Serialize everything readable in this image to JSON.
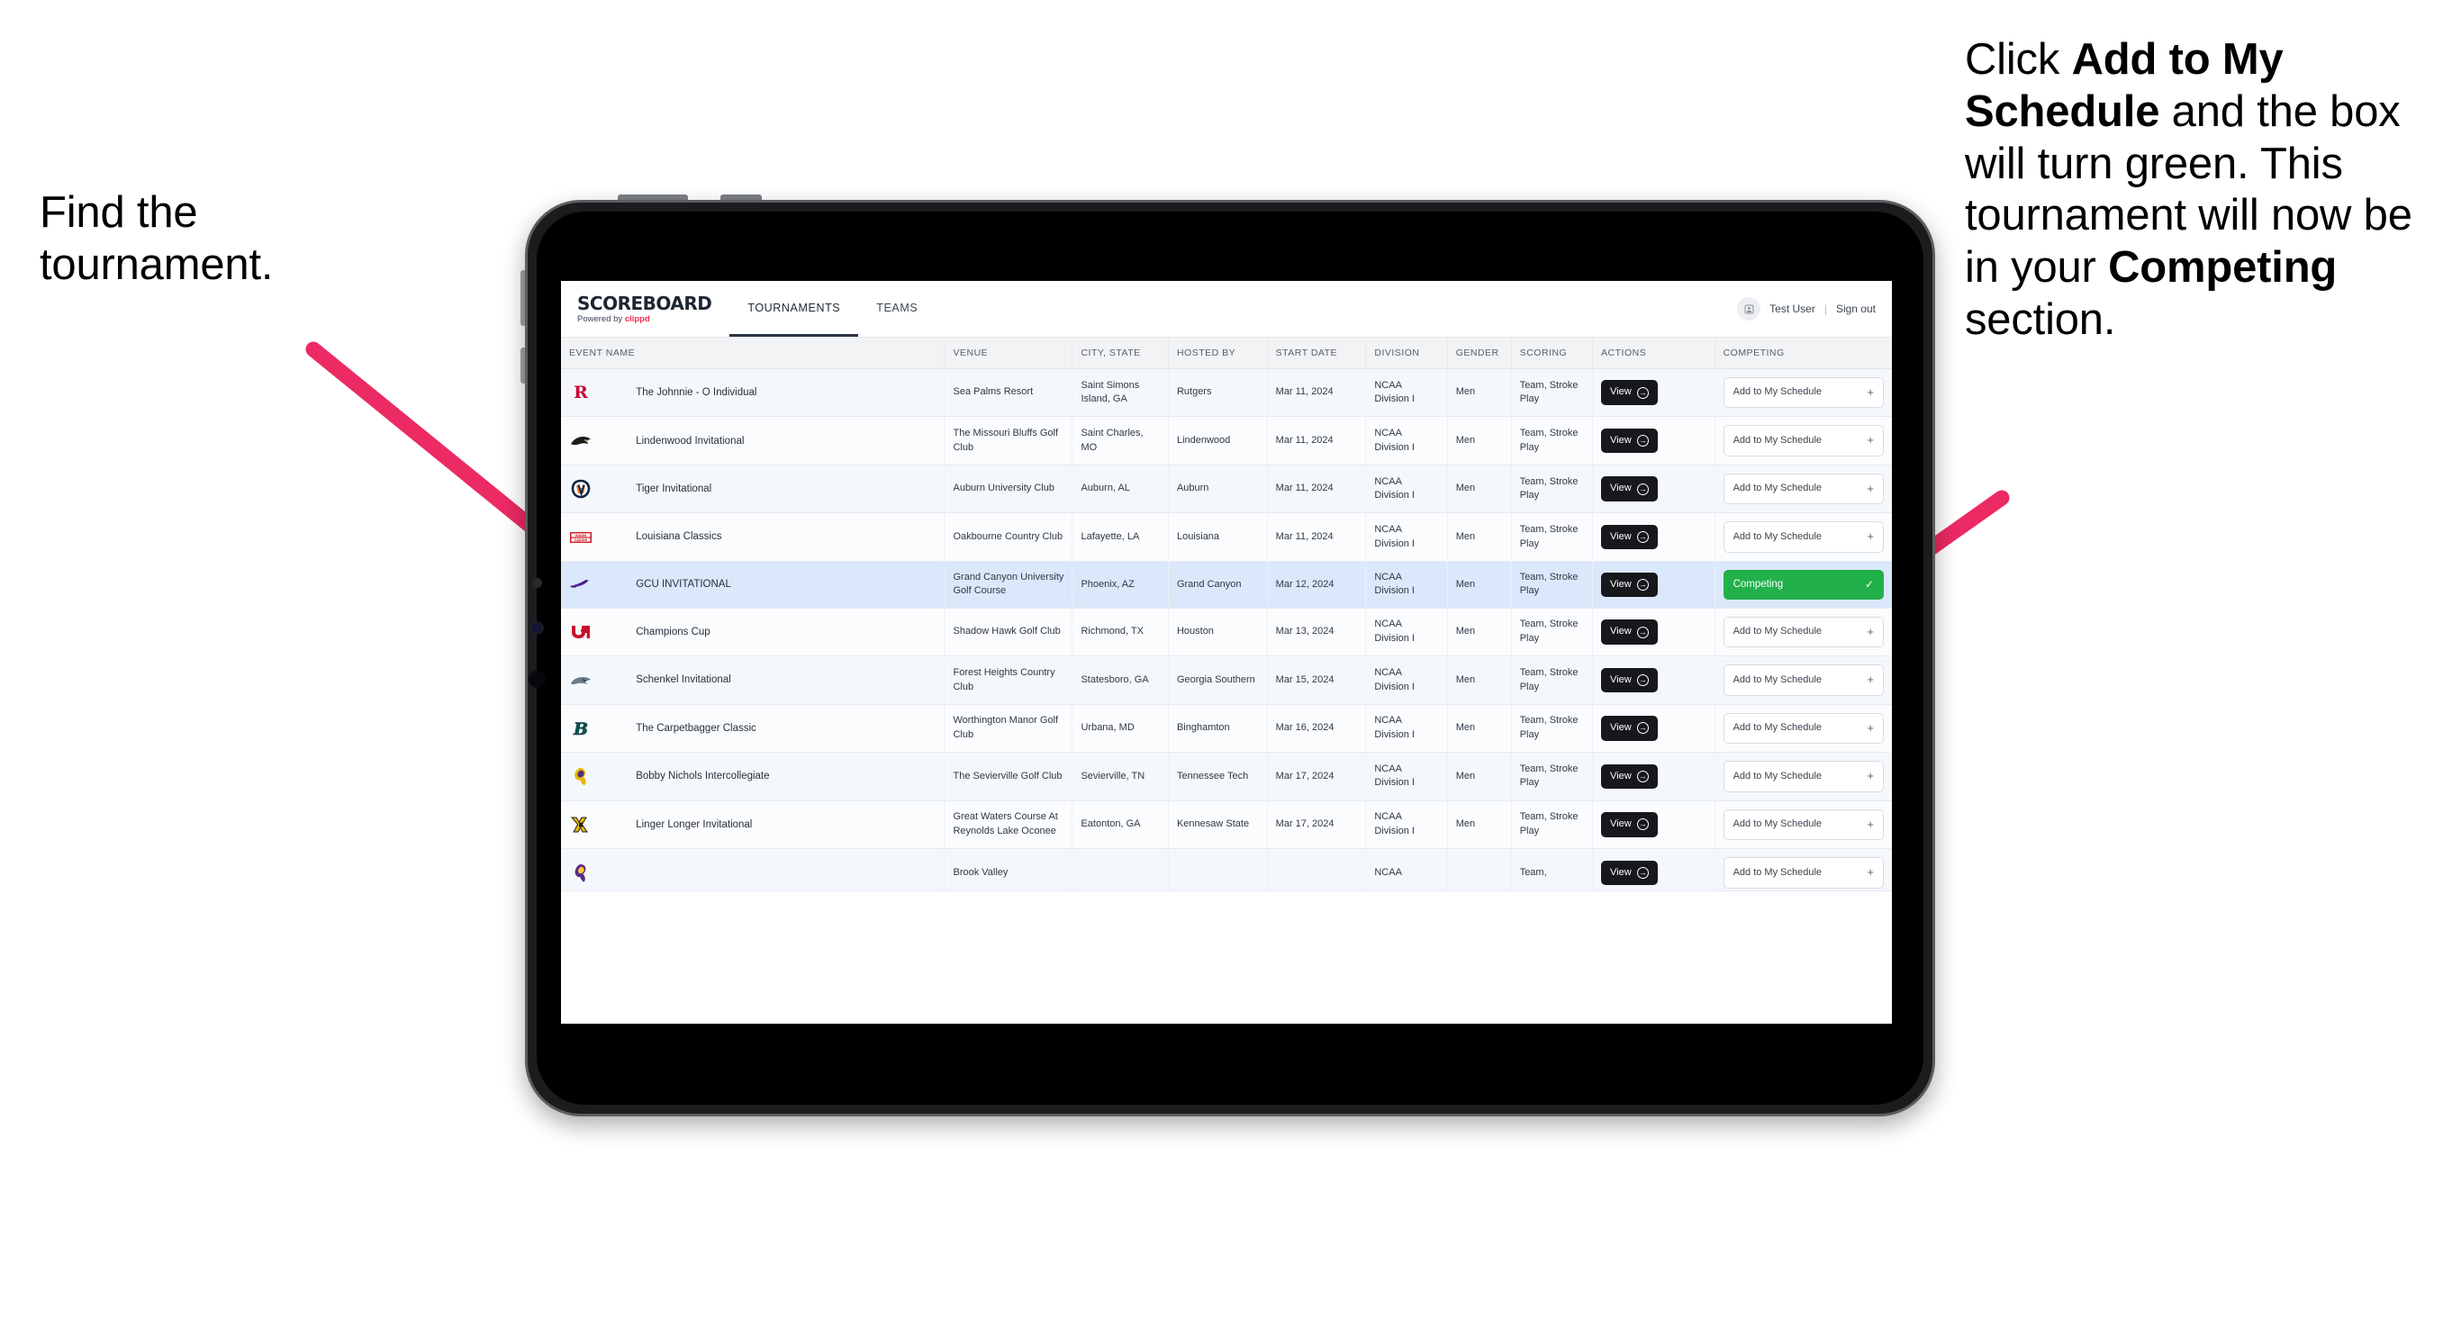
{
  "annotations": {
    "left": "Find the tournament.",
    "right_parts": [
      {
        "t": "Click ",
        "b": false
      },
      {
        "t": "Add to My Schedule",
        "b": true
      },
      {
        "t": " and the box will turn green. This tournament will now be in your ",
        "b": false
      },
      {
        "t": "Competing",
        "b": true
      },
      {
        "t": " section.",
        "b": false
      }
    ],
    "arrow_color": "#ec2a63"
  },
  "app": {
    "brand": {
      "title": "SCOREBOARD",
      "powered_prefix": "Powered by ",
      "powered_brand": "clippd"
    },
    "tabs": [
      {
        "label": "TOURNAMENTS",
        "active": true
      },
      {
        "label": "TEAMS",
        "active": false
      }
    ],
    "header_right": {
      "avatar_icon": "user-avatar-icon",
      "user": "Test User",
      "separator": "|",
      "signout": "Sign out"
    }
  },
  "table": {
    "columns": [
      "",
      "EVENT NAME",
      "VENUE",
      "CITY, STATE",
      "HOSTED BY",
      "START DATE",
      "DIVISION",
      "GENDER",
      "SCORING",
      "ACTIONS",
      "COMPETING"
    ],
    "view_label": "View",
    "add_label": "Add to My Schedule",
    "add_plus": "+",
    "competing_label": "Competing",
    "competing_tick": "✓",
    "rows": [
      {
        "logo": "rutgers",
        "event": "The Johnnie - O Individual",
        "venue": "Sea Palms Resort",
        "city": "Saint Simons Island, GA",
        "host": "Rutgers",
        "date": "Mar 11, 2024",
        "division": "NCAA Division I",
        "gender": "Men",
        "scoring": "Team, Stroke Play",
        "competing": false
      },
      {
        "logo": "lindenwood",
        "event": "Lindenwood Invitational",
        "venue": "The Missouri Bluffs Golf Club",
        "city": "Saint Charles, MO",
        "host": "Lindenwood",
        "date": "Mar 11, 2024",
        "division": "NCAA Division I",
        "gender": "Men",
        "scoring": "Team, Stroke Play",
        "competing": false
      },
      {
        "logo": "auburn",
        "event": "Tiger Invitational",
        "venue": "Auburn University Club",
        "city": "Auburn, AL",
        "host": "Auburn",
        "date": "Mar 11, 2024",
        "division": "NCAA Division I",
        "gender": "Men",
        "scoring": "Team, Stroke Play",
        "competing": false
      },
      {
        "logo": "louisiana",
        "event": "Louisiana Classics",
        "venue": "Oakbourne Country Club",
        "city": "Lafayette, LA",
        "host": "Louisiana",
        "date": "Mar 11, 2024",
        "division": "NCAA Division I",
        "gender": "Men",
        "scoring": "Team, Stroke Play",
        "competing": false
      },
      {
        "logo": "gcu",
        "event": "GCU INVITATIONAL",
        "venue": "Grand Canyon University Golf Course",
        "city": "Phoenix, AZ",
        "host": "Grand Canyon",
        "date": "Mar 12, 2024",
        "division": "NCAA Division I",
        "gender": "Men",
        "scoring": "Team, Stroke Play",
        "competing": true,
        "selected": true
      },
      {
        "logo": "houston",
        "event": "Champions Cup",
        "venue": "Shadow Hawk Golf Club",
        "city": "Richmond, TX",
        "host": "Houston",
        "date": "Mar 13, 2024",
        "division": "NCAA Division I",
        "gender": "Men",
        "scoring": "Team, Stroke Play",
        "competing": false
      },
      {
        "logo": "georgiasouthern",
        "event": "Schenkel Invitational",
        "venue": "Forest Heights Country Club",
        "city": "Statesboro, GA",
        "host": "Georgia Southern",
        "date": "Mar 15, 2024",
        "division": "NCAA Division I",
        "gender": "Men",
        "scoring": "Team, Stroke Play",
        "competing": false
      },
      {
        "logo": "binghamton",
        "event": "The Carpetbagger Classic",
        "venue": "Worthington Manor Golf Club",
        "city": "Urbana, MD",
        "host": "Binghamton",
        "date": "Mar 16, 2024",
        "division": "NCAA Division I",
        "gender": "Men",
        "scoring": "Team, Stroke Play",
        "competing": false
      },
      {
        "logo": "tennesseetech",
        "event": "Bobby Nichols Intercollegiate",
        "venue": "The Sevierville Golf Club",
        "city": "Sevierville, TN",
        "host": "Tennessee Tech",
        "date": "Mar 17, 2024",
        "division": "NCAA Division I",
        "gender": "Men",
        "scoring": "Team, Stroke Play",
        "competing": false
      },
      {
        "logo": "kennesaw",
        "event": "Linger Longer Invitational",
        "venue": "Great Waters Course At Reynolds Lake Oconee",
        "city": "Eatonton, GA",
        "host": "Kennesaw State",
        "date": "Mar 17, 2024",
        "division": "NCAA Division I",
        "gender": "Men",
        "scoring": "Team, Stroke Play",
        "competing": false
      },
      {
        "logo": "ecu",
        "event": "",
        "venue": "Brook Valley",
        "city": "",
        "host": "",
        "date": "",
        "division": "NCAA",
        "gender": "",
        "scoring": "Team,",
        "competing": false,
        "clipped": true
      }
    ]
  }
}
